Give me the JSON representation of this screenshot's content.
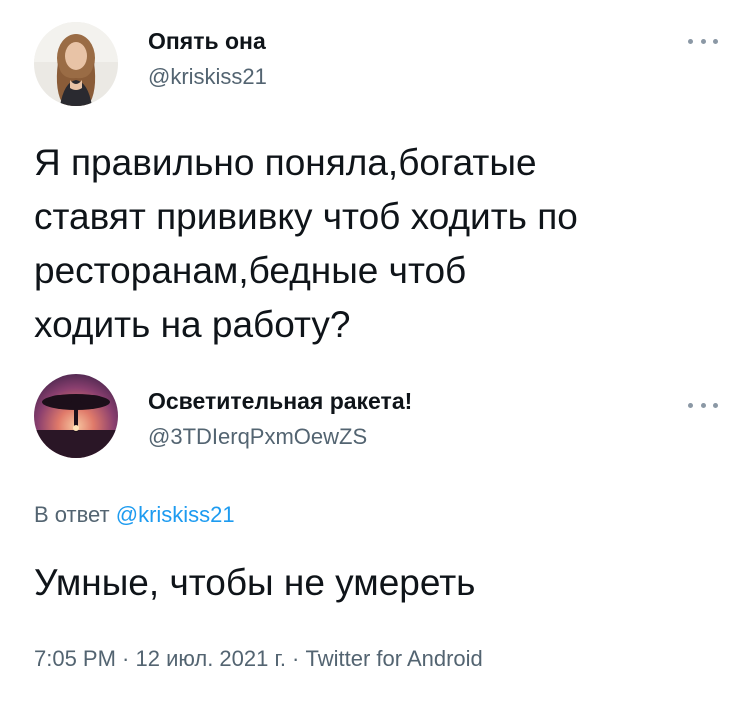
{
  "original_tweet": {
    "display_name": "Опять она",
    "handle": "@kriskiss21",
    "text_lines": [
      "Я правильно поняла,богатые",
      "ставят прививку чтоб ходить по",
      "ресторанам,бедные чтоб",
      "ходить на работу?"
    ]
  },
  "reply_tweet": {
    "display_name": "Осветительная ракета!",
    "handle": "@3TDIerqPxmOewZS",
    "reply_prefix": "В ответ ",
    "reply_handle": "@kriskiss21",
    "text": "Умные, чтобы не умереть",
    "meta": "7:05 PM · 12 июл. 2021 г. · Twitter for Android"
  },
  "icons": {
    "more": "more-horizontal-icon",
    "avatar_1": "woman-portrait-avatar",
    "avatar_2": "sunset-tree-avatar"
  },
  "colors": {
    "text": "#0f1419",
    "secondary": "#536471",
    "link": "#1d9bf0"
  }
}
